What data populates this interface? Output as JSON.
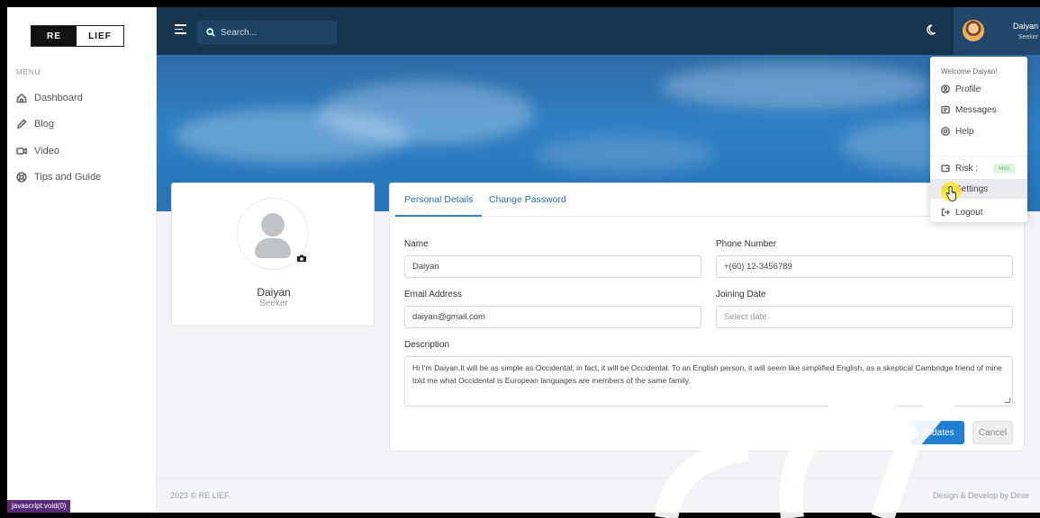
{
  "brand": {
    "part1": "RE",
    "part2": "LIEF"
  },
  "sidebar": {
    "menu_label": "MENU",
    "items": [
      {
        "label": "Dashboard",
        "icon": "home-icon"
      },
      {
        "label": "Blog",
        "icon": "pencil-icon"
      },
      {
        "label": "Video",
        "icon": "video-icon"
      },
      {
        "label": "Tips and Guide",
        "icon": "lifebuoy-icon"
      }
    ]
  },
  "topbar": {
    "search_placeholder": "Search...",
    "user_name": "Daiyan",
    "user_role": "Seeker"
  },
  "profile": {
    "name": "Daiyan",
    "role": "Seeker"
  },
  "tabs": {
    "personal": "Personal Details",
    "password": "Change Password"
  },
  "form": {
    "name_label": "Name",
    "name_value": "Daiyan",
    "phone_label": "Phone Number",
    "phone_value": "+(60) 12-3456789",
    "email_label": "Email Address",
    "email_value": "daiyan@gmail.com",
    "joining_label": "Joining Date",
    "joining_placeholder": "Select date",
    "description_label": "Description",
    "description_value": "Hi I'm Daiyan,It will be as simple as Occidental; in fact, it will be Occidental. To an English person, it will seem like simplified English, as a skeptical Cambridge friend of mine told me what Occidental is European languages are members of the same family.",
    "update_label": "Updates",
    "cancel_label": "Cancel"
  },
  "dropdown": {
    "welcome": "Welcome Daiyan!",
    "profile": "Profile",
    "messages": "Messages",
    "help": "Help",
    "risk": "Risk :",
    "risk_badge": "Mild",
    "settings": "Settings",
    "logout": "Logout"
  },
  "footer": {
    "left": "2023 © RE LIEF.",
    "right": "Design & Develop by Dinie"
  },
  "statusbar": "javascript:void(0)",
  "colors": {
    "topbar": "#16354f",
    "accent": "#1f7fd0",
    "banner": "#2d7fc4"
  }
}
